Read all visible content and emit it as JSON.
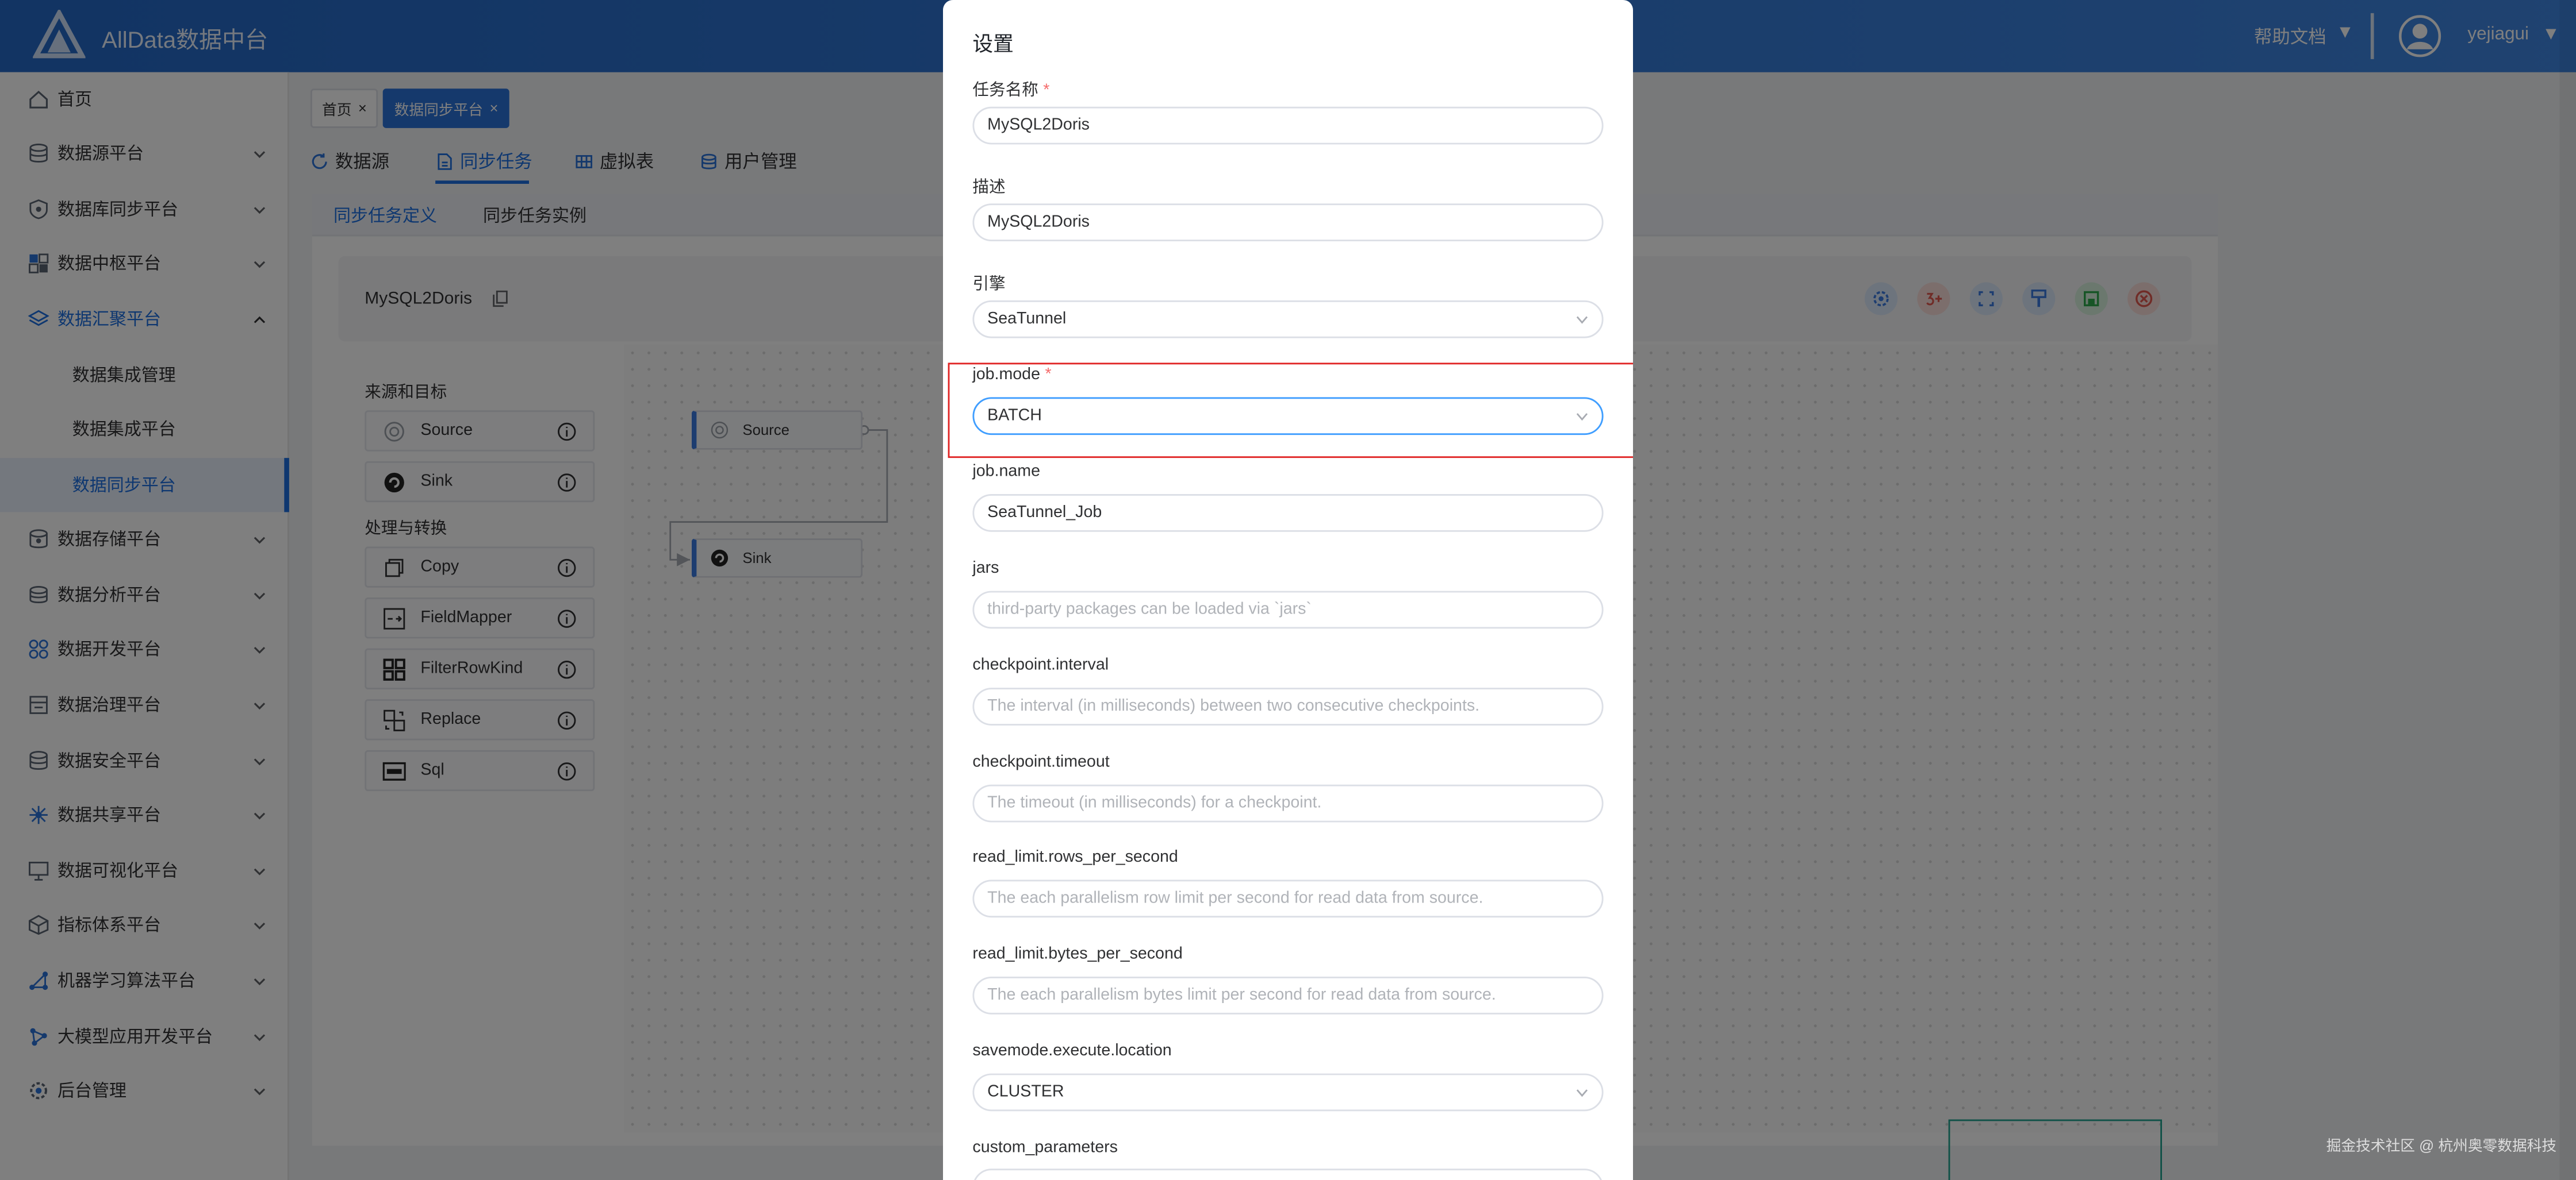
{
  "header": {
    "app_title": "AllData数据中台",
    "help_label": "帮助文档",
    "user_name": "yejiagui",
    "dropdown_glyph": "▼",
    "brand_color": "#2b72d8"
  },
  "sidebar": {
    "items": [
      {
        "label": "首页",
        "icon": "home-icon"
      },
      {
        "label": "数据源平台",
        "icon": "database-icon"
      },
      {
        "label": "数据库同步平台",
        "icon": "shield-icon"
      },
      {
        "label": "数据中枢平台",
        "icon": "grid-icon"
      },
      {
        "label": "数据汇聚平台",
        "icon": "layers-icon",
        "expanded": true
      },
      {
        "label": "数据集成管理",
        "sub": true
      },
      {
        "label": "数据集成平台",
        "sub": true
      },
      {
        "label": "数据同步平台",
        "sub": true,
        "selected": true
      },
      {
        "label": "数据存储平台",
        "icon": "storage-icon"
      },
      {
        "label": "数据分析平台",
        "icon": "analysis-icon"
      },
      {
        "label": "数据开发平台",
        "icon": "dev-icon"
      },
      {
        "label": "数据治理平台",
        "icon": "governance-icon"
      },
      {
        "label": "数据安全平台",
        "icon": "security-icon"
      },
      {
        "label": "数据共享平台",
        "icon": "share-icon"
      },
      {
        "label": "数据可视化平台",
        "icon": "monitor-icon"
      },
      {
        "label": "指标体系平台",
        "icon": "cube-icon"
      },
      {
        "label": "机器学习算法平台",
        "icon": "network-icon"
      },
      {
        "label": "大模型应用开发平台",
        "icon": "model-icon"
      },
      {
        "label": "后台管理",
        "icon": "settings-icon"
      }
    ]
  },
  "tags": [
    {
      "label": "首页",
      "close": "×"
    },
    {
      "label": "数据同步平台",
      "close": "×",
      "active": true
    }
  ],
  "tabs": [
    {
      "label": "数据源",
      "icon": "refresh-icon"
    },
    {
      "label": "同步任务",
      "icon": "document-icon",
      "active": true
    },
    {
      "label": "虚拟表",
      "icon": "table-icon"
    },
    {
      "label": "用户管理",
      "icon": "users-icon"
    }
  ],
  "subtabs": [
    {
      "label": "同步任务定义",
      "active": true
    },
    {
      "label": "同步任务实例"
    }
  ],
  "job": {
    "name": "MySQL2Doris"
  },
  "toolbar": {
    "buttons": [
      {
        "icon": "gear-icon",
        "color": "#3a7be0"
      },
      {
        "icon": "three-plus-icon",
        "color": "#e0584f"
      },
      {
        "icon": "expand-icon",
        "color": "#3a7be0"
      },
      {
        "icon": "brush-icon",
        "color": "#3a7be0"
      },
      {
        "icon": "save-icon",
        "color": "#2eaa4c"
      },
      {
        "icon": "close-circle-icon",
        "color": "#e0584f"
      }
    ]
  },
  "palette": {
    "section1": "来源和目标",
    "section2": "处理与转换",
    "items1": [
      {
        "label": "Source",
        "icon": "source-icon"
      },
      {
        "label": "Sink",
        "icon": "sink-icon"
      }
    ],
    "items2": [
      {
        "label": "Copy",
        "icon": "copy-icon"
      },
      {
        "label": "FieldMapper",
        "icon": "field-mapper-icon"
      },
      {
        "label": "FilterRowKind",
        "icon": "filter-icon"
      },
      {
        "label": "Replace",
        "icon": "replace-icon"
      },
      {
        "label": "Sql",
        "icon": "sql-icon"
      }
    ]
  },
  "canvas": {
    "nodes": [
      {
        "label": "Source",
        "icon": "source-icon"
      },
      {
        "label": "Sink",
        "icon": "sink-icon"
      }
    ]
  },
  "drawer": {
    "title": "设置",
    "required_mark": "*",
    "fields": [
      {
        "label": "任务名称",
        "required": true,
        "value": "MySQL2Doris"
      },
      {
        "label": "描述",
        "value": "MySQL2Doris"
      },
      {
        "label": "引擎",
        "value": "SeaTunnel",
        "select": true
      },
      {
        "label": "job.mode",
        "required": true,
        "value": "BATCH",
        "select": true,
        "focused": true
      },
      {
        "label": "job.name",
        "value": "SeaTunnel_Job"
      },
      {
        "label": "jars",
        "placeholder": "third-party packages can be loaded via `jars`"
      },
      {
        "label": "checkpoint.interval",
        "placeholder": "The interval (in milliseconds) between two consecutive checkpoints."
      },
      {
        "label": "checkpoint.timeout",
        "placeholder": "The timeout (in milliseconds) for a checkpoint."
      },
      {
        "label": "read_limit.rows_per_second",
        "placeholder": "The each parallelism row limit per second for read data from source."
      },
      {
        "label": "read_limit.bytes_per_second",
        "placeholder": "The each parallelism bytes limit per second for read data from source."
      },
      {
        "label": "savemode.execute.location",
        "value": "CLUSTER",
        "select": true
      },
      {
        "label": "custom_parameters",
        "value": ""
      }
    ]
  },
  "watermark": "掘金技术社区 @ 杭州奥零数据科技"
}
